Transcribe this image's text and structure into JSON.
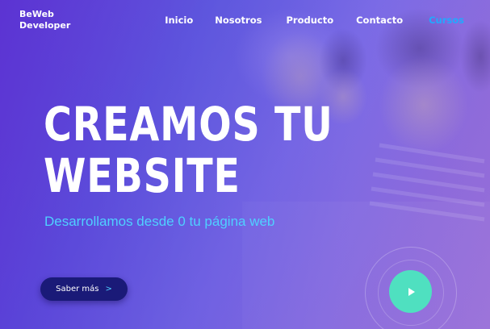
{
  "brand": {
    "line1": "BeWeb",
    "line2": "Developer"
  },
  "nav": {
    "items": [
      {
        "label": "Inicio"
      },
      {
        "label": "Nosotros"
      },
      {
        "label": "Producto"
      },
      {
        "label": "Contacto"
      },
      {
        "label": "Cursos",
        "active": true
      }
    ]
  },
  "hero": {
    "headline_line1": "CREAMOS TU",
    "headline_line2": "WEBSITE",
    "subtitle": "Desarrollamos desde 0 tu página web",
    "cta_label": "Saber más",
    "cta_icon": ">",
    "play_icon": "play-icon"
  },
  "colors": {
    "accent": "#4fd0ff",
    "active_nav": "#22a8ff",
    "cta_bg": "#1a1a78",
    "play_bg": "#4fe0c0",
    "gradient_start": "#6a3fd4",
    "gradient_end": "#9a6fd6"
  }
}
